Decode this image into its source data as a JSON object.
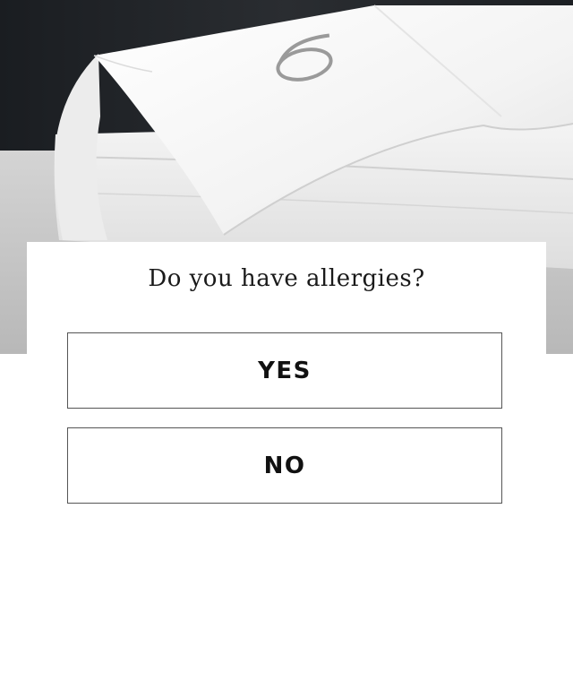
{
  "hero": {
    "image": "folded-white-comforter-with-embroidered-logo",
    "colors": {
      "backdrop": "#202327",
      "surface": "#c9c9c9",
      "comforter": "#f4f4f4",
      "logo_stitch": "#9a9a9a"
    }
  },
  "quiz": {
    "question": "Do you have allergies?",
    "options": [
      {
        "label": "YES"
      },
      {
        "label": "NO"
      }
    ]
  }
}
